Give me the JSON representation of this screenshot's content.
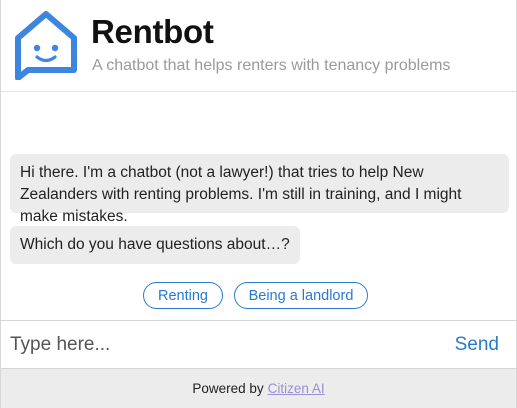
{
  "header": {
    "title": "Rentbot",
    "subtitle": "A chatbot that helps renters with tenancy problems",
    "logo_icon": "house-chat-face-icon"
  },
  "messages": [
    {
      "sender": "bot",
      "text": "Hi there. I'm a chatbot (not a lawyer!) that tries to help New Zealanders with renting problems. I'm still in training, and I might make mistakes."
    },
    {
      "sender": "bot",
      "text": "Which do you have questions about…?"
    }
  ],
  "quick_replies": [
    {
      "label": "Renting"
    },
    {
      "label": "Being a landlord"
    }
  ],
  "input": {
    "placeholder": "Type here...",
    "value": "",
    "send_label": "Send"
  },
  "footer": {
    "powered_by": "Powered by",
    "link_text": "Citizen AI"
  },
  "colors": {
    "accent": "#2a79d0",
    "logo": "#3d86e0",
    "bubble": "#ececec",
    "footer_link": "#9b8fd6"
  }
}
